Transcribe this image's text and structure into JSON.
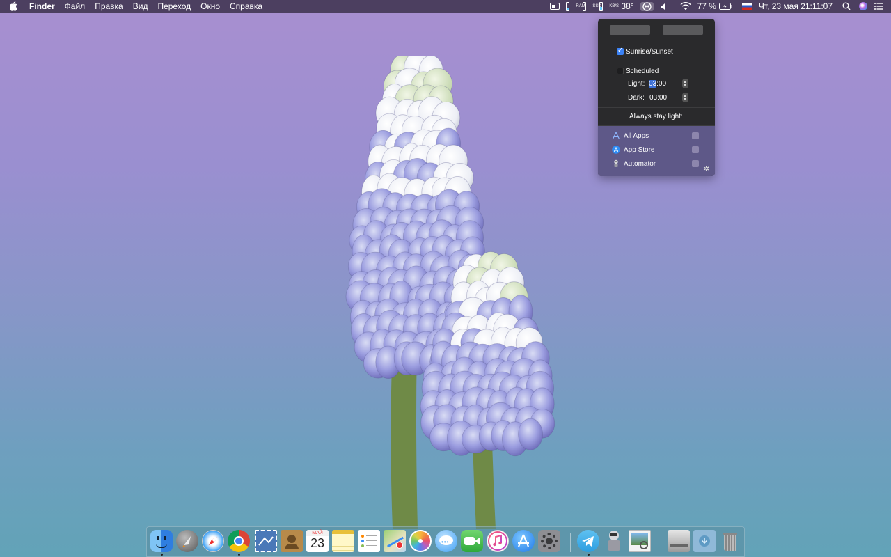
{
  "menubar": {
    "app_name": "Finder",
    "items": [
      "Файл",
      "Правка",
      "Вид",
      "Переход",
      "Окно",
      "Справка"
    ],
    "status": {
      "temperature": "38°",
      "battery_percent": "77 %",
      "datetime": "Чт, 23 мая  21:11:07"
    }
  },
  "popover": {
    "sunrise_sunset_label": "Sunrise/Sunset",
    "sunrise_sunset_checked": true,
    "scheduled_label": "Scheduled",
    "scheduled_checked": false,
    "light_label": "Light:",
    "light_hours": "03",
    "light_rest": ":00",
    "dark_label": "Dark:",
    "dark_time": "03:00",
    "always_light_label": "Always stay light:",
    "apps": [
      {
        "name": "All Apps",
        "icon": "app-store-outline-icon"
      },
      {
        "name": "App Store",
        "icon": "app-store-icon"
      },
      {
        "name": "Automator",
        "icon": "automator-icon"
      }
    ]
  },
  "dock": {
    "calendar_month": "МАЙ",
    "calendar_day": "23",
    "apps": [
      "finder",
      "launchpad",
      "safari",
      "chrome",
      "mail",
      "contacts",
      "calendar",
      "notes",
      "reminders",
      "maps",
      "photos",
      "messages",
      "facetime",
      "itunes",
      "app-store",
      "system-preferences",
      "telegram",
      "automator",
      "preview",
      "hard-drive",
      "downloads",
      "trash"
    ]
  }
}
